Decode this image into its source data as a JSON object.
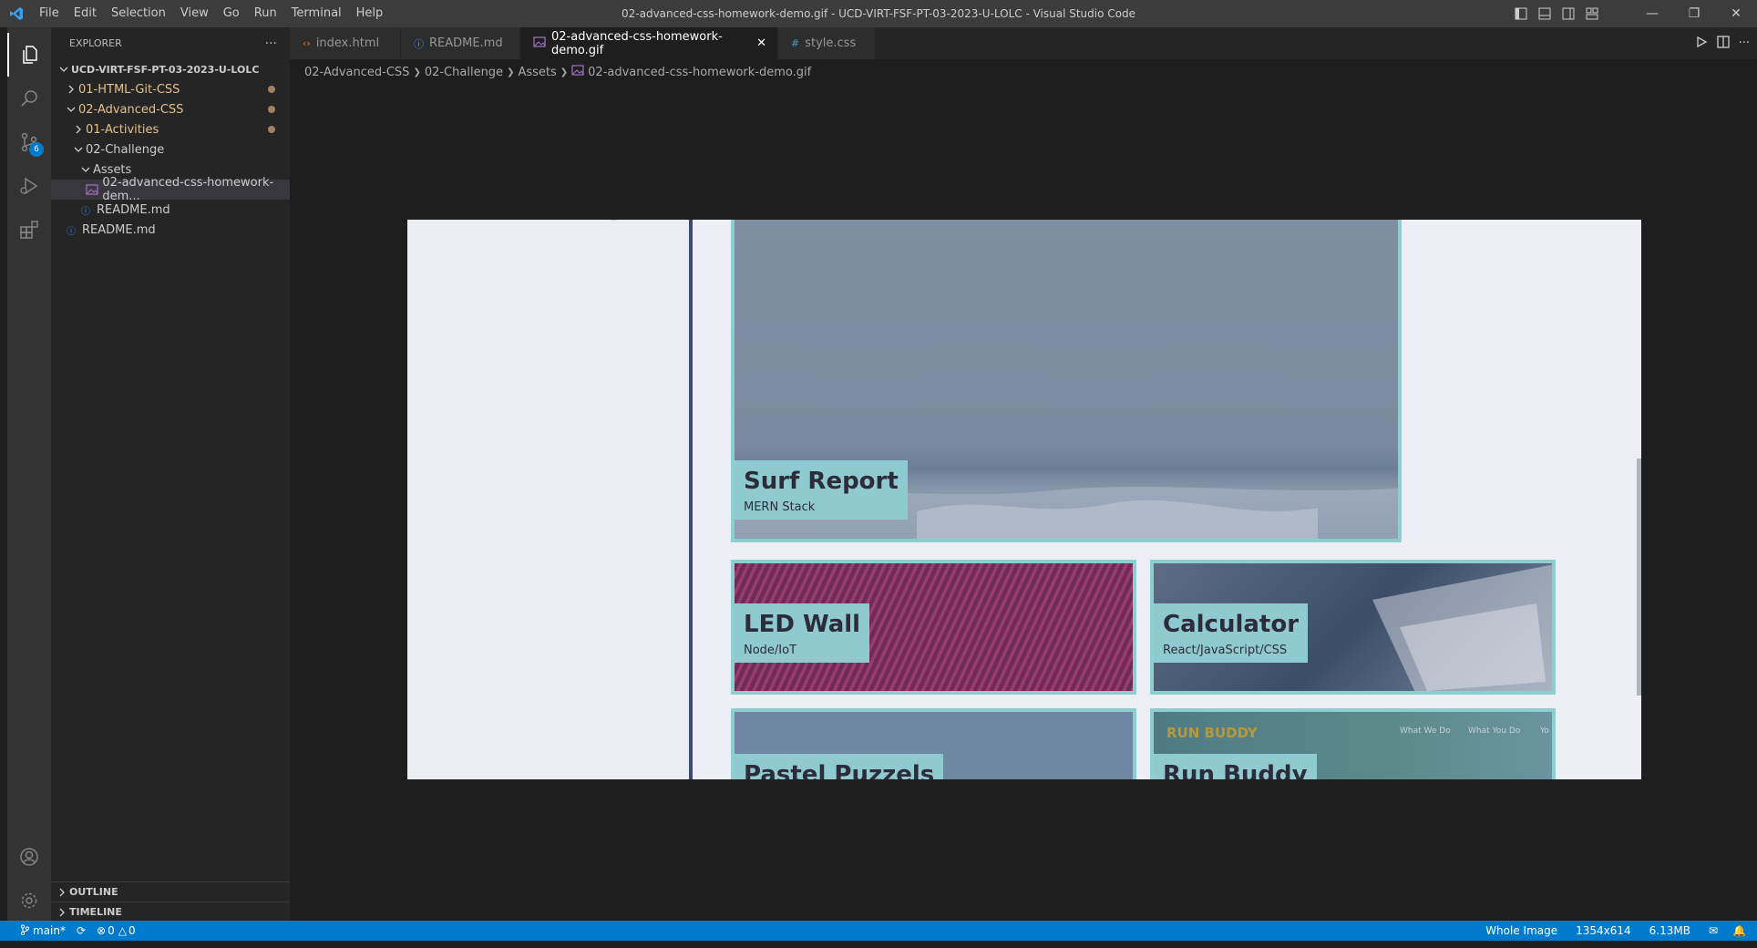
{
  "titlebar": {
    "menu": [
      "File",
      "Edit",
      "Selection",
      "View",
      "Go",
      "Run",
      "Terminal",
      "Help"
    ],
    "title": "02-advanced-css-homework-demo.gif - UCD-VIRT-FSF-PT-03-2023-U-LOLC - Visual Studio Code"
  },
  "activity": {
    "scm_badge": "6"
  },
  "sidebar": {
    "header": "EXPLORER",
    "more": "···",
    "root": "UCD-VIRT-FSF-PT-03-2023-U-LOLC",
    "items": [
      {
        "label": "01-HTML-Git-CSS"
      },
      {
        "label": "02-Advanced-CSS"
      },
      {
        "label": "01-Activities"
      },
      {
        "label": "02-Challenge"
      },
      {
        "label": "Assets"
      },
      {
        "label": "02-advanced-css-homework-dem..."
      },
      {
        "label": "README.md"
      },
      {
        "label": "README.md"
      }
    ],
    "outline": "OUTLINE",
    "timeline": "TIMELINE"
  },
  "tabs": [
    {
      "label": "index.html",
      "icon": "html-icon"
    },
    {
      "label": "README.md",
      "icon": "info-icon"
    },
    {
      "label": "02-advanced-css-homework-demo.gif",
      "icon": "image-icon"
    },
    {
      "label": "style.css",
      "icon": "css-icon"
    }
  ],
  "breadcrumb": [
    "02-Advanced-CSS",
    "02-Challenge",
    "Assets",
    "02-advanced-css-homework-demo.gif"
  ],
  "preview": {
    "cards": [
      {
        "title": "Surf Report",
        "sub": "MERN Stack"
      },
      {
        "title": "LED Wall",
        "sub": "Node/IoT"
      },
      {
        "title": "Calculator",
        "sub": "React/JavaScript/CSS"
      },
      {
        "title": "Pastel Puzzels",
        "sub": ""
      },
      {
        "title": "Run Buddy",
        "sub": ""
      }
    ],
    "run_buddy_logo": "RUN BUDDY",
    "run_buddy_nav": [
      "What We Do",
      "What You Do",
      "Yo"
    ]
  },
  "statusbar": {
    "branch": "main*",
    "errors": "0",
    "warnings": "0",
    "zoom": "Whole Image",
    "dimensions": "1354x614",
    "size": "6.13MB"
  },
  "colors": {
    "accent": "#007acc",
    "card_border": "#8dcfcf",
    "card_label": "#8ecad0"
  }
}
